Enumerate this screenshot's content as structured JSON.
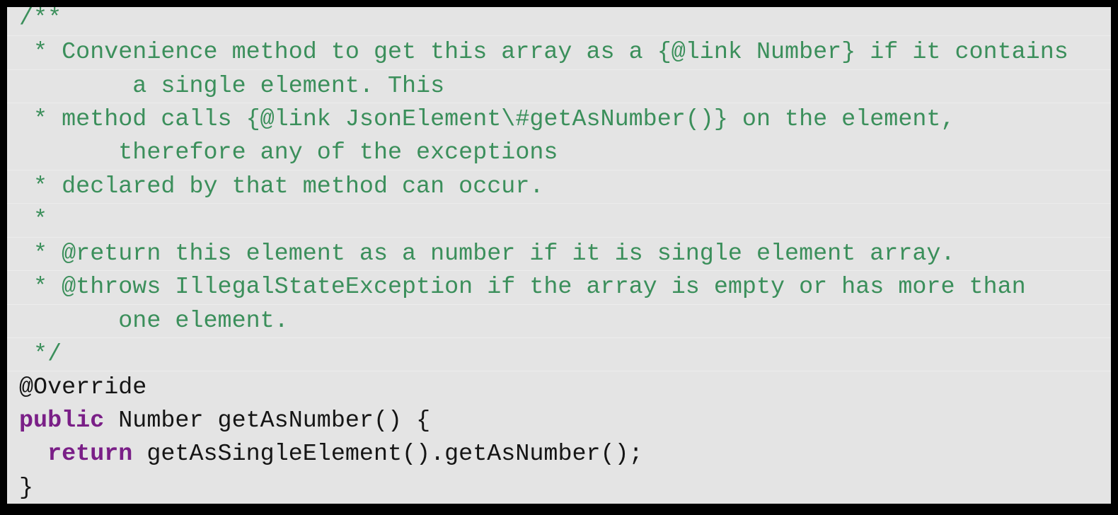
{
  "code": {
    "language": "java",
    "colors": {
      "comment": "#3b8f5b",
      "keyword": "#7a1f87",
      "plain": "#151515",
      "background": "#e4e4e4",
      "border": "#000000"
    },
    "lines": [
      {
        "kind": "comment",
        "text": "/**"
      },
      {
        "kind": "comment",
        "text": " * Convenience method to get this array as a {@link Number} if it contains"
      },
      {
        "kind": "comment",
        "text": "        a single element. This"
      },
      {
        "kind": "comment",
        "text": " * method calls {@link JsonElement\\#getAsNumber()} on the element,"
      },
      {
        "kind": "comment",
        "text": "       therefore any of the exceptions"
      },
      {
        "kind": "comment",
        "text": " * declared by that method can occur."
      },
      {
        "kind": "comment",
        "text": " *"
      },
      {
        "kind": "comment",
        "text": " * @return this element as a number if it is single element array."
      },
      {
        "kind": "comment",
        "text": " * @throws IllegalStateException if the array is empty or has more than"
      },
      {
        "kind": "comment",
        "text": "       one element."
      },
      {
        "kind": "comment",
        "text": " */"
      },
      {
        "kind": "plain",
        "text": "@Override"
      },
      {
        "kind": "mixed",
        "keyword": "public",
        "rest": " Number getAsNumber() {"
      },
      {
        "kind": "mixed",
        "indent": "  ",
        "keyword": "return",
        "rest": " getAsSingleElement().getAsNumber();"
      },
      {
        "kind": "plain",
        "text": "}"
      }
    ]
  }
}
